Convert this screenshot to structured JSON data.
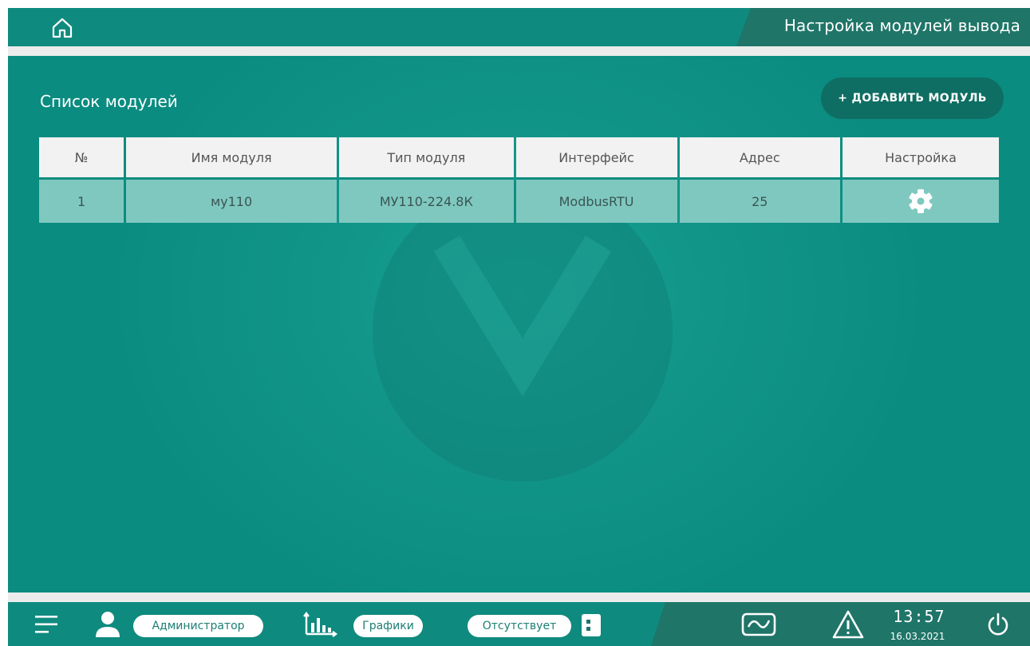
{
  "header": {
    "title": "Настройка модулей вывода"
  },
  "content": {
    "section_title": "Список модулей",
    "add_button_label": "+ ДОБАВИТЬ МОДУЛЬ"
  },
  "table": {
    "columns": [
      "№",
      "Имя модуля",
      "Тип модуля",
      "Интерфейс",
      "Адрес",
      "Настройка"
    ],
    "rows": [
      {
        "num": "1",
        "name": "му110",
        "type": "МУ110-224.8К",
        "interface": "ModbusRTU",
        "address": "25",
        "settings_icon": "gear-icon"
      }
    ]
  },
  "footer": {
    "user_label": "Администратор",
    "charts_label": "Графики",
    "status_label": "Отсутствует",
    "time": "13:57",
    "date": "16.03.2021"
  },
  "colors": {
    "background": "#0b8c80",
    "header_panel": "#1f7568",
    "table_header": "#f2f2f2",
    "table_row": "#7fc8c0",
    "button": "#0f6e63"
  },
  "icons": [
    "home-icon",
    "menu-icon",
    "user-icon",
    "charts-icon",
    "status-icon",
    "signal-icon",
    "warning-icon",
    "power-icon",
    "gear-icon"
  ]
}
